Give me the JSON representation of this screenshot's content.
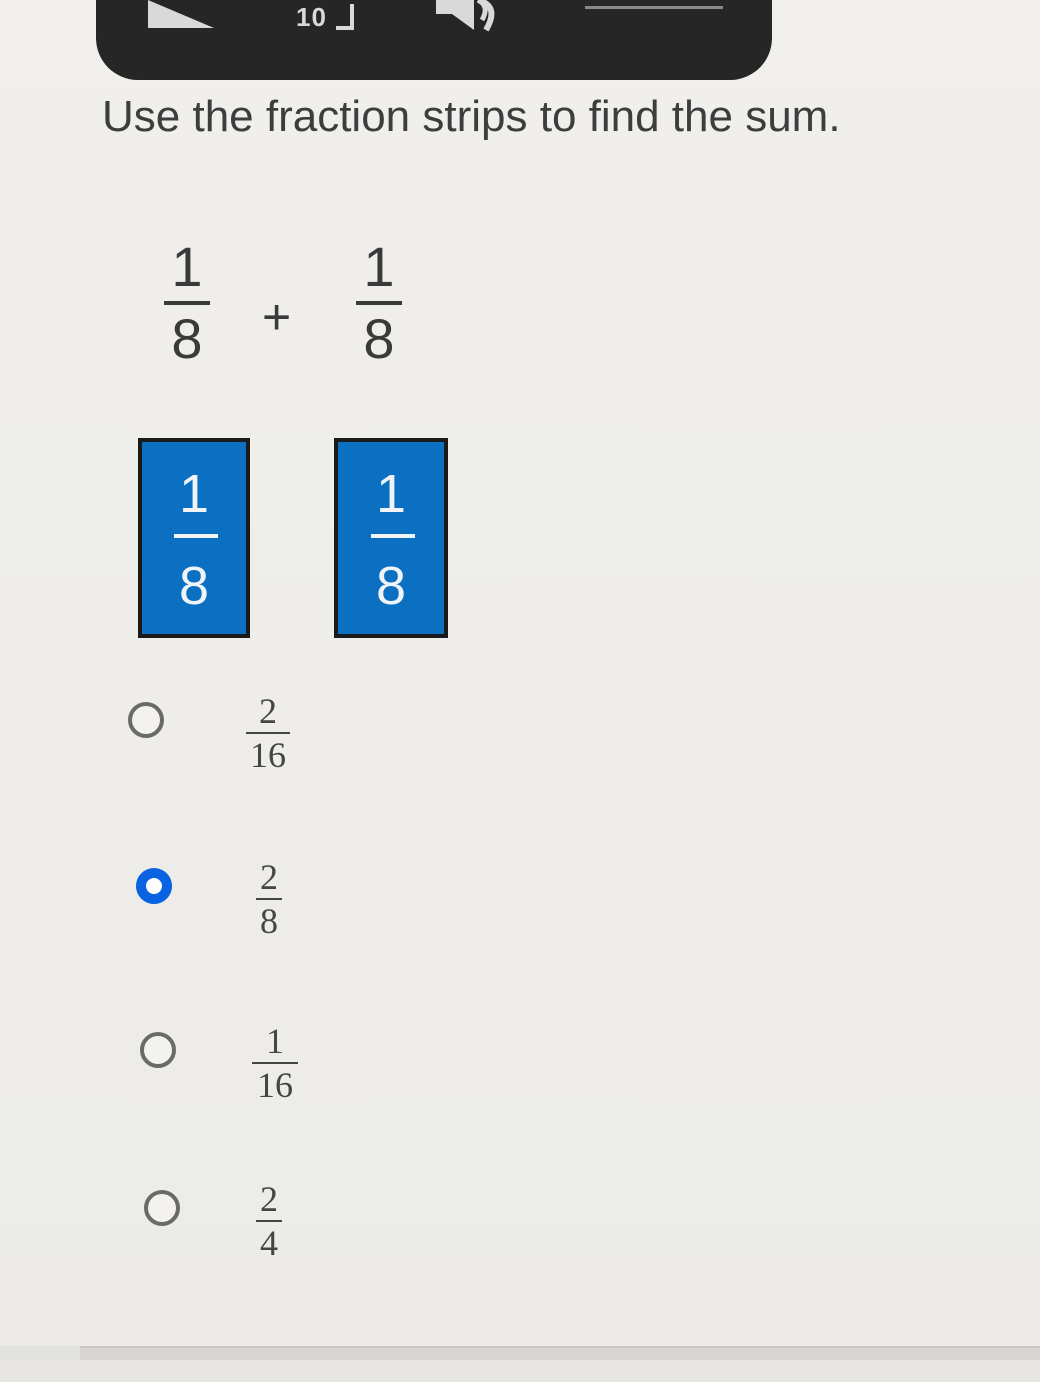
{
  "player": {
    "rewind_label": "10",
    "play_icon": "play-icon",
    "speaker_icon": "speaker-icon"
  },
  "question": {
    "prompt": "Use the fraction strips to find the sum.",
    "operator": "+",
    "addend_1": {
      "numerator": "1",
      "denominator": "8"
    },
    "addend_2": {
      "numerator": "1",
      "denominator": "8"
    }
  },
  "strips": [
    {
      "numerator": "1",
      "denominator": "8"
    },
    {
      "numerator": "1",
      "denominator": "8"
    }
  ],
  "strip_color": "#0b6fc2",
  "options": [
    {
      "numerator": "2",
      "denominator": "16",
      "selected": false
    },
    {
      "numerator": "2",
      "denominator": "8",
      "selected": true
    },
    {
      "numerator": "1",
      "denominator": "16",
      "selected": false
    },
    {
      "numerator": "2",
      "denominator": "4",
      "selected": false
    }
  ],
  "selected_color": "#0a63e0"
}
